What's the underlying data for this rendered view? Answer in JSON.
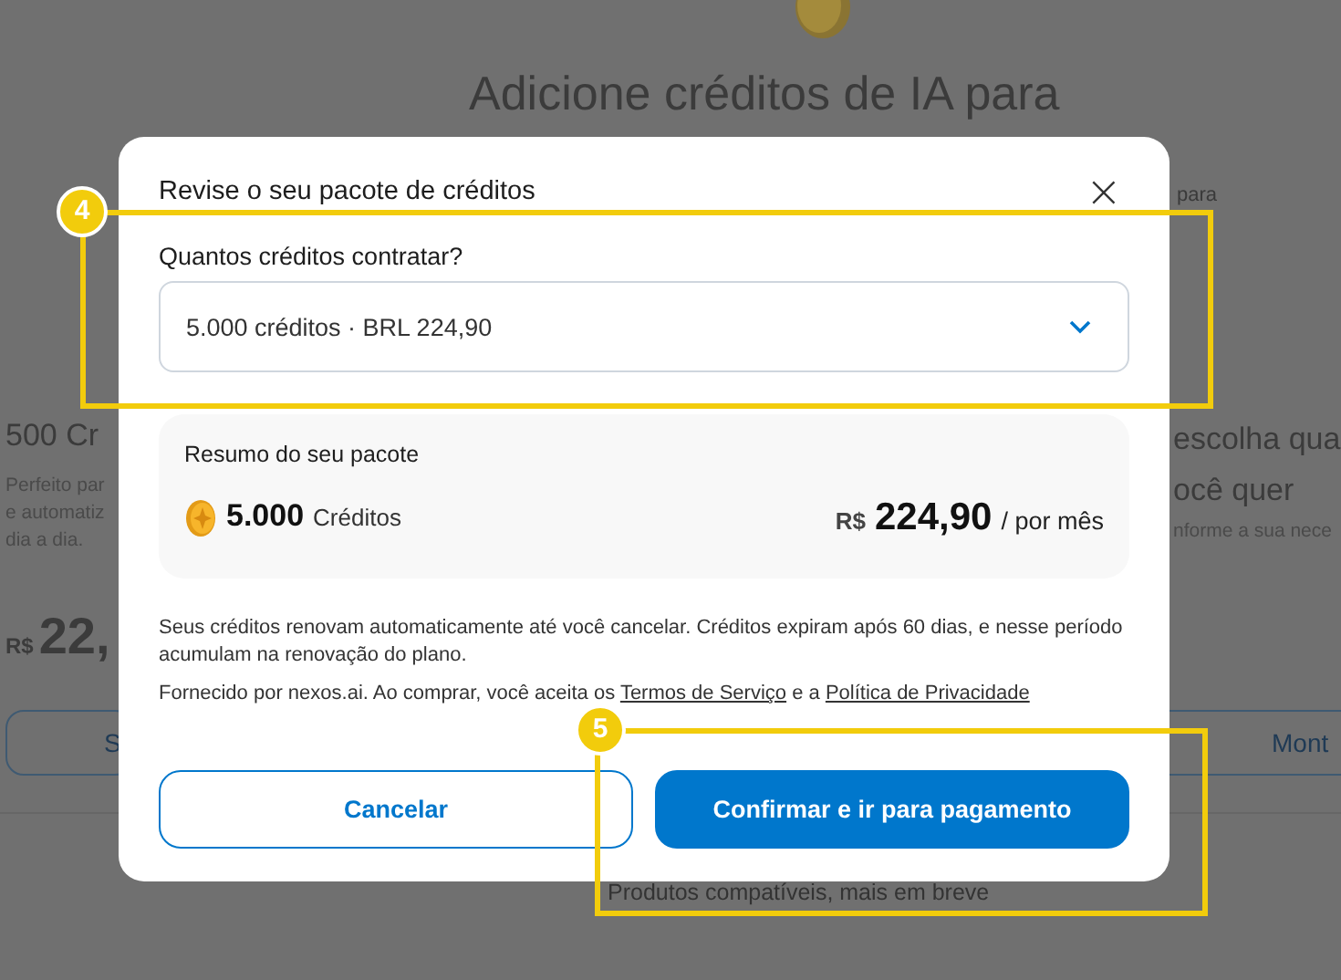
{
  "background": {
    "heading": "Adicione créditos de IA para",
    "side_text": "para",
    "left_card": {
      "title": "500 Cr",
      "lines": [
        "Perfeito par",
        "e automatiz",
        "dia a dia."
      ],
      "currency": "R$",
      "price": "22,",
      "button": "S"
    },
    "right_card": {
      "title_lines": [
        "escolha qua",
        "ocê quer"
      ],
      "text": "nforme a sua nece",
      "button": "Mont"
    },
    "footer_text": "Produtos compatíveis, mais em breve"
  },
  "dialog": {
    "title": "Revise o seu pacote de créditos",
    "close": "×",
    "select": {
      "label": "Quantos créditos contratar?",
      "value": "5.000 créditos · BRL 224,90"
    },
    "summary": {
      "title": "Resumo do seu pacote",
      "amount": "5.000",
      "unit": "Créditos",
      "currency": "R$",
      "price": "224,90",
      "period": "/ por mês"
    },
    "notes": [
      "Seus créditos renovam automaticamente até você cancelar. Créditos expiram após 60 dias, e nesse período acumulam na renovação do plano."
    ],
    "legal": {
      "text": "Fornecido por nexos.ai. Ao comprar, você aceita os",
      "terms": "Termos de Serviço",
      "joiner": "e a",
      "privacy": "Política de Privacidade"
    },
    "buttons": [
      {
        "label": "Cancelar",
        "kind": "secondary"
      },
      {
        "label": "Confirmar e ir para pagamento",
        "kind": "primary"
      }
    ]
  },
  "callouts": [
    {
      "number": "4"
    },
    {
      "number": "5"
    }
  ]
}
